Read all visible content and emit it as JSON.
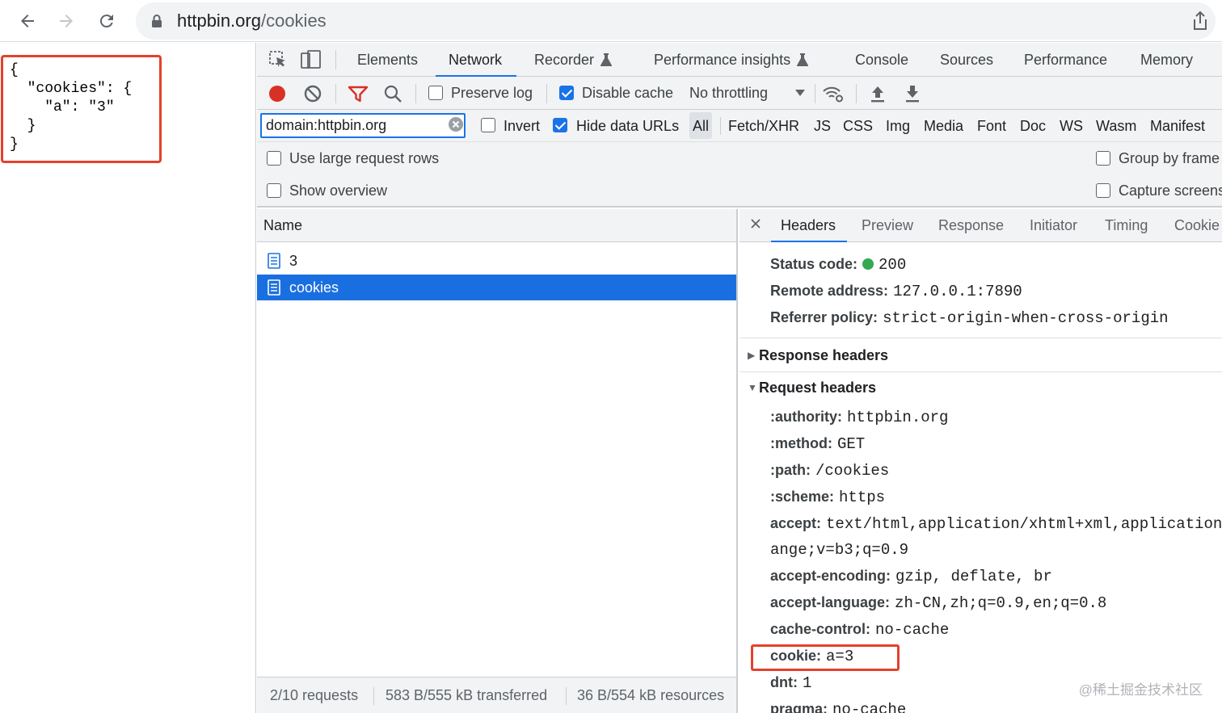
{
  "browser": {
    "url_host": "httpbin.org",
    "url_path": "/cookies"
  },
  "page": {
    "json_text": "{\n  \"cookies\": {\n    \"a\": \"3\"\n  }\n}"
  },
  "devtools": {
    "tabs": [
      "Elements",
      "Network",
      "Recorder",
      "Performance insights",
      "Console",
      "Sources",
      "Performance",
      "Memory"
    ],
    "toolbar": {
      "preserve_log": "Preserve log",
      "disable_cache": "Disable cache",
      "throttling": "No throttling"
    },
    "filter": {
      "value": "domain:httpbin.org",
      "invert": "Invert",
      "hide_data_urls": "Hide data URLs",
      "types": [
        "All",
        "Fetch/XHR",
        "JS",
        "CSS",
        "Img",
        "Media",
        "Font",
        "Doc",
        "WS",
        "Wasm",
        "Manifest"
      ]
    },
    "options": {
      "large_rows": "Use large request rows",
      "show_overview": "Show overview",
      "group_by_frame": "Group by frame",
      "capture_screenshots": "Capture screens"
    },
    "requests": {
      "column_name": "Name",
      "rows": [
        "3",
        "cookies"
      ],
      "footer": {
        "requests": "2/10 requests",
        "transferred": "583 B/555 kB transferred",
        "resources": "36 B/554 kB resources"
      }
    },
    "details": {
      "tabs": [
        "Headers",
        "Preview",
        "Response",
        "Initiator",
        "Timing",
        "Cookie"
      ],
      "general": {
        "status_key": "Status code:",
        "status_val": "200",
        "remote_key": "Remote address:",
        "remote_val": "127.0.0.1:7890",
        "referrer_key": "Referrer policy:",
        "referrer_val": "strict-origin-when-cross-origin"
      },
      "response_headers": "Response headers",
      "request_headers_title": "Request headers",
      "request_headers": [
        {
          "k": ":authority:",
          "v": "httpbin.org"
        },
        {
          "k": ":method:",
          "v": "GET"
        },
        {
          "k": ":path:",
          "v": "/cookies"
        },
        {
          "k": ":scheme:",
          "v": "https"
        },
        {
          "k": "accept:",
          "v": "text/html,application/xhtml+xml,application/"
        },
        {
          "k": "",
          "v": "ange;v=b3;q=0.9"
        },
        {
          "k": "accept-encoding:",
          "v": "gzip, deflate, br"
        },
        {
          "k": "accept-language:",
          "v": "zh-CN,zh;q=0.9,en;q=0.8"
        },
        {
          "k": "cache-control:",
          "v": "no-cache"
        },
        {
          "k": "cookie:",
          "v": "a=3"
        },
        {
          "k": "dnt:",
          "v": "1"
        },
        {
          "k": "pragma:",
          "v": "no-cache"
        }
      ]
    }
  },
  "watermark": "@稀土掘金技术社区"
}
